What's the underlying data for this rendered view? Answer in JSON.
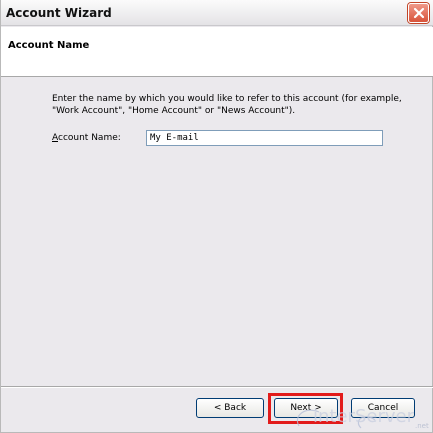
{
  "window": {
    "title": "Account Wizard",
    "close_icon": "close-icon"
  },
  "header": {
    "title": "Account Name"
  },
  "content": {
    "instructions": "Enter the name by which you would like to refer to this account (for example, \"Work Account\", \"Home Account\" or \"News Account\").",
    "field_label_prefix": "A",
    "field_label_rest": "ccount Name:",
    "field_value": "My E-mail"
  },
  "buttons": {
    "back": "< Back",
    "next": "Next >",
    "cancel": "Cancel"
  },
  "colors": {
    "highlight": "#e21b1b",
    "dialog_bg": "#ebe9ed",
    "close_button": "#d8533a"
  }
}
